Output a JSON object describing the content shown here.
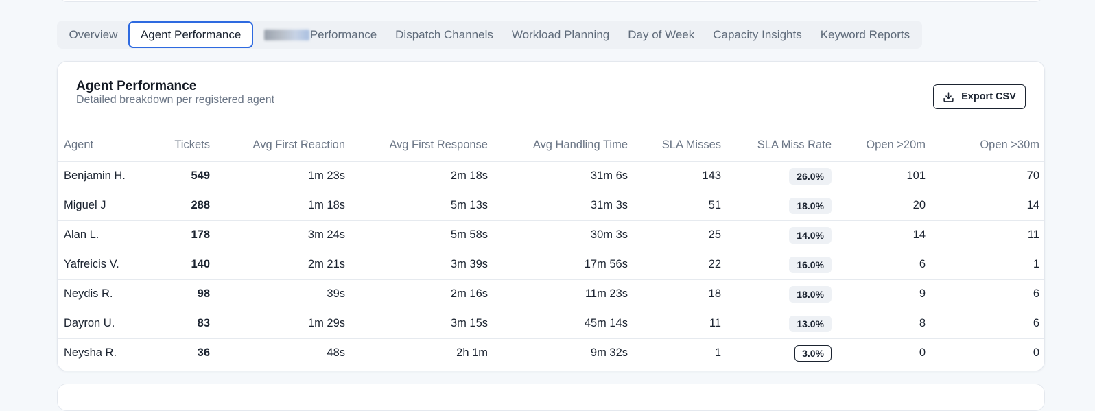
{
  "tabs": [
    {
      "label": "Overview"
    },
    {
      "label": "Agent Performance",
      "active": true
    },
    {
      "label": "Performance",
      "obscured_prefix": true
    },
    {
      "label": "Dispatch Channels"
    },
    {
      "label": "Workload Planning"
    },
    {
      "label": "Day of Week"
    },
    {
      "label": "Capacity Insights"
    },
    {
      "label": "Keyword Reports"
    }
  ],
  "card": {
    "title": "Agent Performance",
    "subtitle": "Detailed breakdown per registered agent",
    "export_label": "Export CSV",
    "export_icon": "download-icon"
  },
  "table": {
    "columns": [
      "Agent",
      "Tickets",
      "Avg First Reaction",
      "Avg First Response",
      "Avg Handling Time",
      "SLA Misses",
      "SLA Miss Rate",
      "Open >20m",
      "Open >30m"
    ],
    "rows": [
      {
        "agent": "Benjamin H.",
        "tickets": "549",
        "reaction": "1m 23s",
        "response": "2m 18s",
        "handling": "31m 6s",
        "sla_misses": "143",
        "sla_rate": "26.0%",
        "open20": "101",
        "open30": "70"
      },
      {
        "agent": "Miguel J",
        "tickets": "288",
        "reaction": "1m 18s",
        "response": "5m 13s",
        "handling": "31m 3s",
        "sla_misses": "51",
        "sla_rate": "18.0%",
        "open20": "20",
        "open30": "14"
      },
      {
        "agent": "Alan L.",
        "tickets": "178",
        "reaction": "3m 24s",
        "response": "5m 58s",
        "handling": "30m 3s",
        "sla_misses": "25",
        "sla_rate": "14.0%",
        "open20": "14",
        "open30": "11"
      },
      {
        "agent": "Yafreicis V.",
        "tickets": "140",
        "reaction": "2m 21s",
        "response": "3m 39s",
        "handling": "17m 56s",
        "sla_misses": "22",
        "sla_rate": "16.0%",
        "open20": "6",
        "open30": "1"
      },
      {
        "agent": "Neydis R.",
        "tickets": "98",
        "reaction": "39s",
        "response": "2m 16s",
        "handling": "11m 23s",
        "sla_misses": "18",
        "sla_rate": "18.0%",
        "open20": "9",
        "open30": "6"
      },
      {
        "agent": "Dayron U.",
        "tickets": "83",
        "reaction": "1m 29s",
        "response": "3m 15s",
        "handling": "45m 14s",
        "sla_misses": "11",
        "sla_rate": "13.0%",
        "open20": "8",
        "open30": "6"
      },
      {
        "agent": "Neysha R.",
        "tickets": "36",
        "reaction": "48s",
        "response": "2h 1m",
        "handling": "9m 32s",
        "sla_misses": "1",
        "sla_rate": "3.0%",
        "sla_rate_outlined": true,
        "open20": "0",
        "open30": "0"
      }
    ]
  },
  "colors": {
    "accent": "#2e6ae0",
    "background": "#f5f8fb",
    "badge_bg": "#eef1f5",
    "muted_text": "#6b7686"
  }
}
